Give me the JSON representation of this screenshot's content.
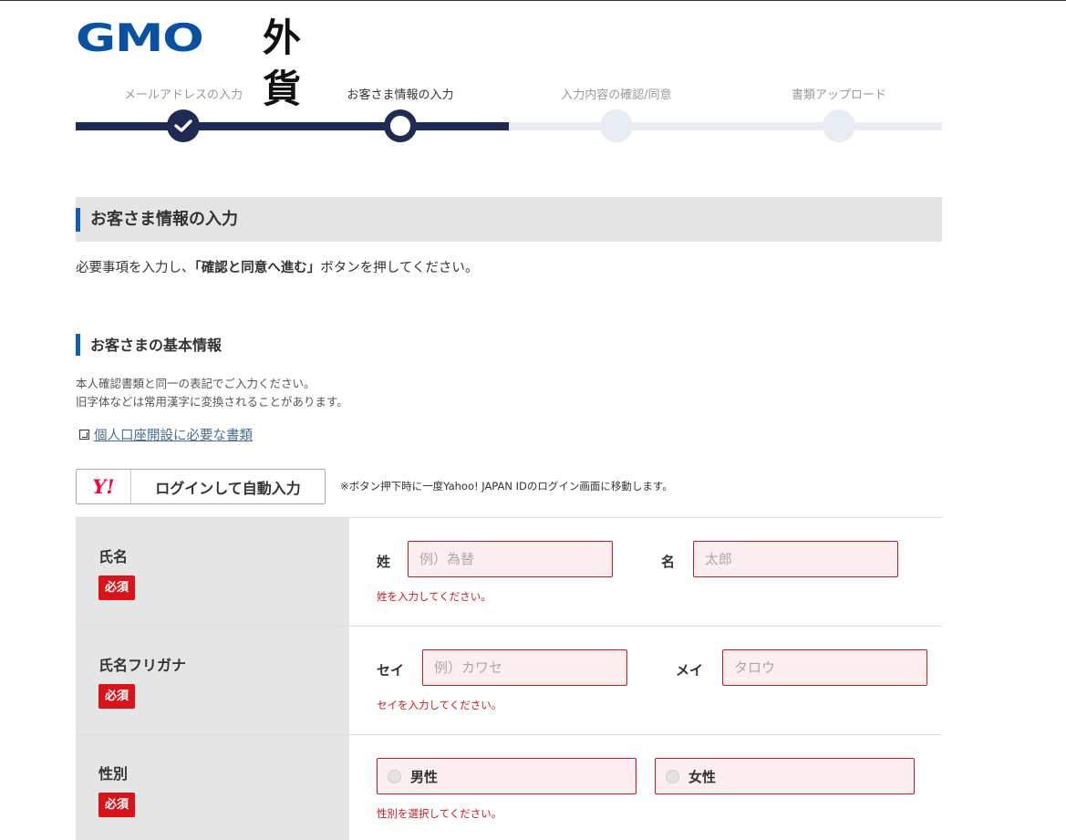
{
  "logo": {
    "gmo": "GMO",
    "fx": "外貨",
    "gmo_color": "#0a51a1"
  },
  "steps": [
    {
      "label": "メールアドレスの入力",
      "state": "done"
    },
    {
      "label": "お客さま情報の入力",
      "state": "current"
    },
    {
      "label": "入力内容の確認/同意",
      "state": "pending"
    },
    {
      "label": "書類アップロード",
      "state": "pending"
    }
  ],
  "section": {
    "title": "お客さま情報の入力"
  },
  "intro": {
    "before": "必要事項を入力し、",
    "strong": "「確認と同意へ進む」",
    "after": "ボタンを押してください。"
  },
  "basic": {
    "title": "お客さまの基本情報",
    "note_line1": "本人確認書類と同一の表記でご入力ください。",
    "note_line2": "旧字体などは常用漢字に変換されることがあります。",
    "doc_link": "個人口座開設に必要な書類"
  },
  "yahoo": {
    "logo_text": "Y!",
    "button_label": "ログインして自動入力",
    "note": "※ボタン押下時に一度Yahoo! JAPAN IDのログイン画面に移動します。"
  },
  "form": {
    "required_badge": "必須",
    "name": {
      "label": "氏名",
      "last_label": "姓",
      "last_placeholder": "例）為替",
      "last_value": "",
      "first_label": "名",
      "first_placeholder": "太郎",
      "first_value": "",
      "error": "姓を入力してください。"
    },
    "kana": {
      "label": "氏名フリガナ",
      "last_label": "セイ",
      "last_placeholder": "例）カワセ",
      "last_value": "",
      "first_label": "メイ",
      "first_placeholder": "タロウ",
      "first_value": "",
      "error": "セイを入力してください。"
    },
    "gender": {
      "label": "性別",
      "options": [
        "男性",
        "女性"
      ],
      "error": "性別を選択してください。"
    }
  },
  "colors": {
    "navy": "#1f2b52",
    "accent_blue": "#0f5fb4",
    "required_red": "#d7141a",
    "error_red": "#d0171f",
    "input_bg": "#fdeef0",
    "yahoo_red": "#ff0033"
  }
}
